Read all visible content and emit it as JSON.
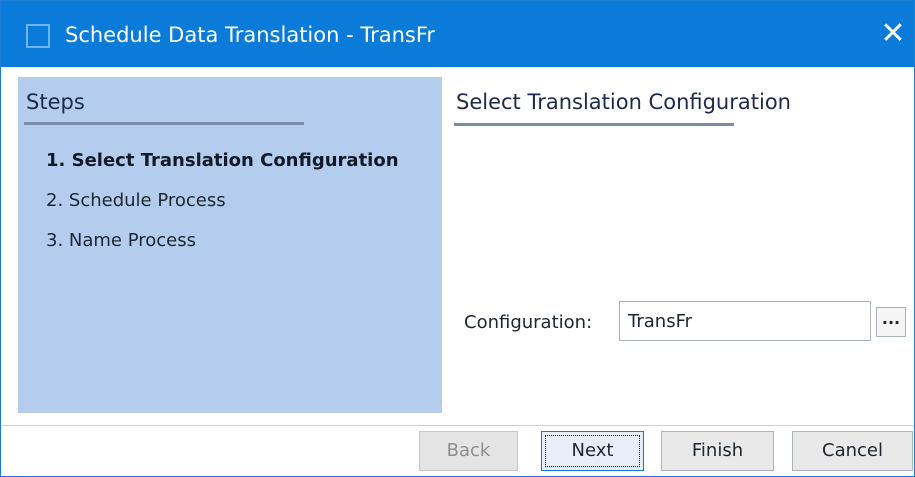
{
  "window": {
    "title": "Schedule Data Translation - TransFr",
    "close_icon": "close-icon",
    "close_glyph": "✕"
  },
  "steps": {
    "heading": "Steps",
    "items": [
      {
        "label": "1. Select Translation Configuration",
        "active": true
      },
      {
        "label": "2. Schedule Process",
        "active": false
      },
      {
        "label": "3. Name Process",
        "active": false
      }
    ]
  },
  "content": {
    "title": "Select Translation Configuration",
    "configuration_label": "Configuration:",
    "configuration_value": "TransFr",
    "browse_label": "..."
  },
  "buttons": {
    "back": "Back",
    "next": "Next",
    "finish": "Finish",
    "cancel": "Cancel"
  },
  "colors": {
    "titlebar": "#0a7bd8",
    "steps_panel": "#b4cdef"
  }
}
